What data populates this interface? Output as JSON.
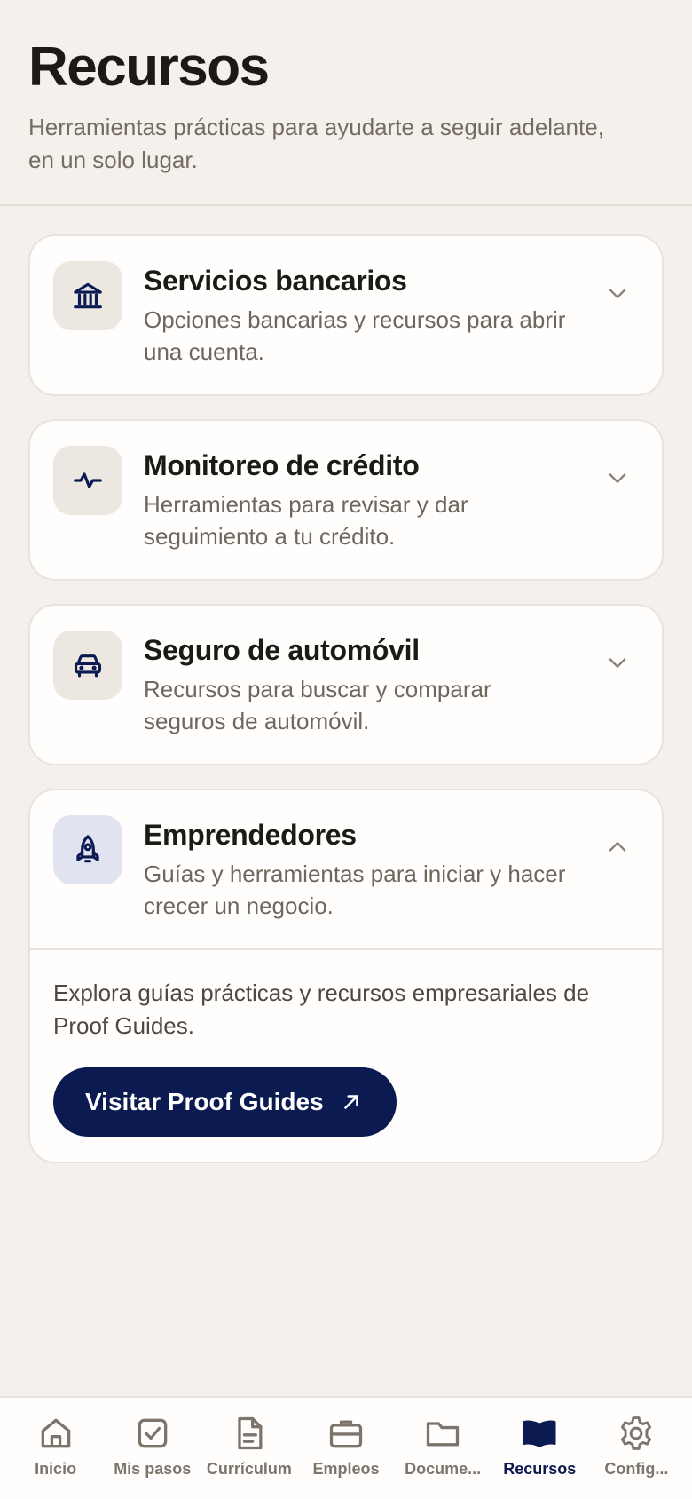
{
  "header": {
    "title": "Recursos",
    "subtitle": "Herramientas prácticas para ayudarte a seguir adelante, en un solo lugar."
  },
  "cards": [
    {
      "title": "Servicios bancarios",
      "description": "Opciones bancarias y recursos para abrir una cuenta.",
      "icon": "bank-icon",
      "expanded": false
    },
    {
      "title": "Monitoreo de crédito",
      "description": "Herramientas para revisar y dar seguimiento a tu crédito.",
      "icon": "pulse-icon",
      "expanded": false
    },
    {
      "title": "Seguro de automóvil",
      "description": "Recursos para buscar y comparar seguros de automóvil.",
      "icon": "car-icon",
      "expanded": false
    },
    {
      "title": "Emprendedores",
      "description": "Guías y herramientas para iniciar y hacer crecer un negocio.",
      "icon": "rocket-icon",
      "expanded": true,
      "body_text": "Explora guías prácticas y recursos empresariales de Proof Guides.",
      "cta_label": "Visitar Proof Guides"
    }
  ],
  "bottom_nav": [
    {
      "label": "Inicio",
      "icon": "home-icon",
      "active": false
    },
    {
      "label": "Mis pasos",
      "icon": "checkbox-icon",
      "active": false
    },
    {
      "label": "Currículum",
      "icon": "document-icon",
      "active": false
    },
    {
      "label": "Empleos",
      "icon": "briefcase-icon",
      "active": false
    },
    {
      "label": "Docume...",
      "icon": "folder-icon",
      "active": false
    },
    {
      "label": "Recursos",
      "icon": "book-icon",
      "active": true
    },
    {
      "label": "Config...",
      "icon": "gear-icon",
      "active": false
    }
  ],
  "colors": {
    "background": "#f4f0eb",
    "card": "#fffefc",
    "accent": "#0c1a52",
    "muted_text": "#6f675e",
    "inactive_nav": "#7d756b"
  }
}
